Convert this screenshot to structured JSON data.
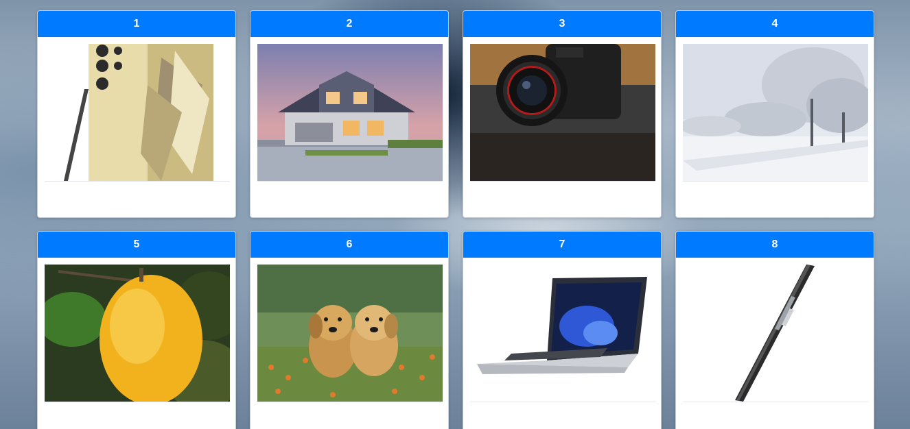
{
  "cards": [
    {
      "number": "1",
      "image": "phone-image"
    },
    {
      "number": "2",
      "image": "house-image"
    },
    {
      "number": "3",
      "image": "camera-image"
    },
    {
      "number": "4",
      "image": "winter-trees-image"
    },
    {
      "number": "5",
      "image": "mango-image"
    },
    {
      "number": "6",
      "image": "puppies-image"
    },
    {
      "number": "7",
      "image": "laptop-image"
    },
    {
      "number": "8",
      "image": "pen-image"
    }
  ],
  "colors": {
    "header": "#007bff",
    "header_text": "#ffffff",
    "card_background": "#ffffff"
  }
}
